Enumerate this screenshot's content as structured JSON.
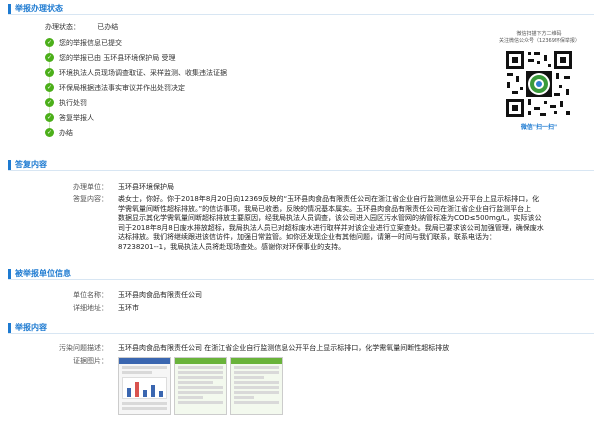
{
  "sections": {
    "status": "举报办理状态",
    "reply": "答复内容",
    "reported": "被举报单位信息",
    "report": "举报内容"
  },
  "status": {
    "label": "办理状态：",
    "value": "已办结"
  },
  "steps": [
    "您的举报信息已提交",
    "您的举报已由 玉环县环境保护局 受理",
    "环境执法人员现场调查取证、采样监测、收集违法证据",
    "环保局根据违法事实审议并作出处罚决定",
    "执行处罚",
    "答复举报人",
    "办结"
  ],
  "qr": {
    "caption1": "微信扫描下方二维码",
    "caption2": "关注微信公众号（12369环保举报）",
    "footer": "微信\"扫一扫\""
  },
  "reply": {
    "unit_label": "办理单位：",
    "unit_value": "玉环县环境保护局",
    "content_label": "答复内容：",
    "lines": [
      "裘女士，你好。你于2018年8月20日向12369反映的“玉环县肉食品有限责任公司在浙江省企业自行监测信息公开平台上显示标排口，化",
      "学需氧量间断性超标排放。”的信访事项，我局已收悉，反映的情况基本属实。玉环县肉食品有限责任公司在浙江省企业自行监测平台上",
      "数据显示其化学需氧量间断超标排放主要原因，经我局执法人员调查，该公司进入园区污水管网的纳管标准为COD≤500mg/L，实际该公",
      "司于2018年8月8日废水排放超标，我局执法人员已对超标废水进行取样并对该企业进行立案查处。我局已要求该公司加强管理，确保废水",
      "达标排放。我们将继续跟进该信访件，加强日常监管。如你还发现企业有其他问题，请第一时间与我们联系，联系电话为：",
      "87238201--1，我局执法人员将赴现场查处。感谢你对环保事业的支持。"
    ]
  },
  "reported": {
    "name_label": "单位名称：",
    "name_value": "玉环县肉食品有限责任公司",
    "addr_label": "详细地址：",
    "addr_value": "玉环市"
  },
  "report": {
    "desc_label": "污染问题描述：",
    "desc_value": "玉环县肉食品有限责任公司 在浙江省企业自行监测信息公开平台上显示标排口，化学需氧量间断性超标排放",
    "evidence_label": "证据图片："
  }
}
